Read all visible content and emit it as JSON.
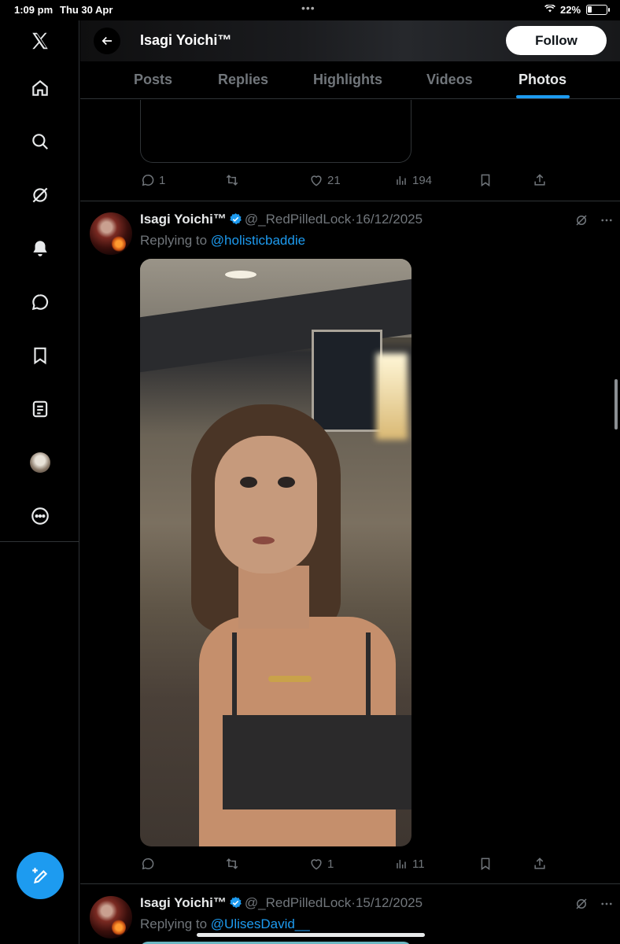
{
  "status_bar": {
    "time": "1:09 pm",
    "date": "Thu 30 Apr",
    "battery": "22%",
    "battery_level": 0.22
  },
  "header": {
    "title": "Isagi Yoichi™",
    "follow_label": "Follow"
  },
  "tabs": [
    {
      "label": "Posts",
      "active": false
    },
    {
      "label": "Replies",
      "active": false
    },
    {
      "label": "Highlights",
      "active": false
    },
    {
      "label": "Videos",
      "active": false
    },
    {
      "label": "Photos",
      "active": true
    }
  ],
  "nav": [
    "x-logo",
    "home-icon",
    "search-icon",
    "grok-icon",
    "notifications-icon",
    "messages-icon",
    "bookmarks-icon",
    "lists-icon",
    "profile-avatar",
    "more-icon"
  ],
  "colors": {
    "accent": "#1d9bf0",
    "background": "#000000",
    "muted": "#71767b",
    "text": "#e7e9ea"
  },
  "previous_tweet": {
    "actions": {
      "replies": "1",
      "reposts": "",
      "likes": "21",
      "views": "194"
    }
  },
  "tweets": [
    {
      "name": "Isagi Yoichi™",
      "handle": "@_RedPilledLock",
      "date": "16/12/2025",
      "replying_prefix": "Replying to",
      "replying_to": "@holisticbaddie",
      "has_photo": true,
      "actions": {
        "replies": "",
        "reposts": "",
        "likes": "1",
        "views": "11"
      }
    },
    {
      "name": "Isagi Yoichi™",
      "handle": "@_RedPilledLock",
      "date": "15/12/2025",
      "replying_prefix": "Replying to",
      "replying_to": "@UlisesDavid__"
    }
  ]
}
